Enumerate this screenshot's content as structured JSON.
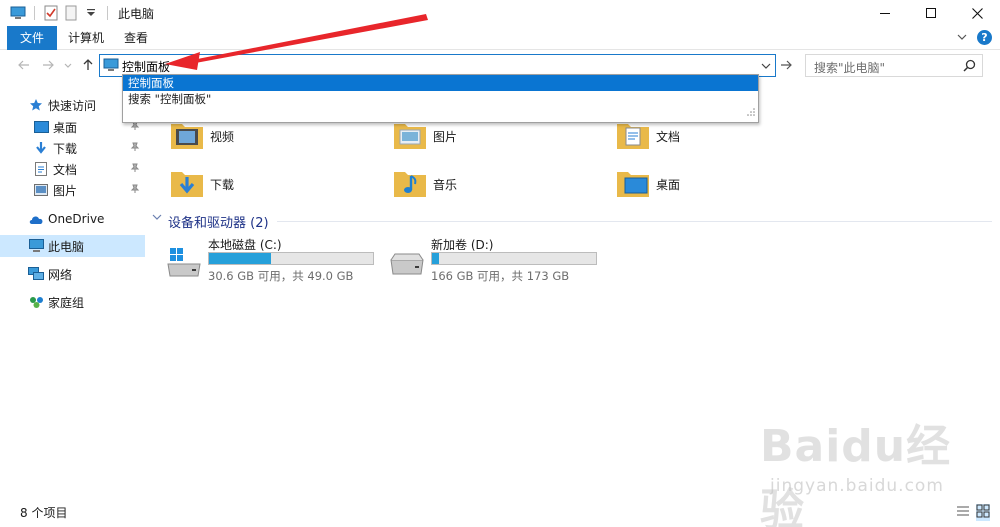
{
  "titlebar": {
    "title": "此电脑"
  },
  "ribbon": {
    "tabs": [
      "文件",
      "计算机",
      "查看"
    ],
    "help_label": "?"
  },
  "address": {
    "value": "控制面板",
    "search_placeholder": "搜索\"此电脑\""
  },
  "suggestions": {
    "items": [
      "控制面板",
      "搜索 \"控制面板\""
    ]
  },
  "nav": {
    "quick_access": "快速访问",
    "desktop": "桌面",
    "downloads": "下载",
    "documents": "文档",
    "pictures": "图片",
    "onedrive": "OneDrive",
    "this_pc": "此电脑",
    "network": "网络",
    "homegroup": "家庭组"
  },
  "folders": {
    "videos": "视频",
    "pictures": "图片",
    "documents": "文档",
    "downloads": "下载",
    "music": "音乐",
    "desktop": "桌面"
  },
  "devices": {
    "heading": "设备和驱动器 (2)",
    "drives": [
      {
        "name": "本地磁盘 (C:)",
        "info": "30.6 GB 可用，共 49.0 GB",
        "used_fraction": 0.38
      },
      {
        "name": "新加卷 (D:)",
        "info": "166 GB 可用，共 173 GB",
        "used_fraction": 0.04
      }
    ]
  },
  "status": {
    "item_count": "8 个项目"
  },
  "watermark": {
    "main": "Baidu经验",
    "sub": "jingyan.baidu.com"
  },
  "colors": {
    "accent": "#1979ca",
    "selection": "#0a75d2",
    "nav_selected": "#cce8ff",
    "drive_fill": "#26a0da",
    "annotation": "#e8262b"
  }
}
